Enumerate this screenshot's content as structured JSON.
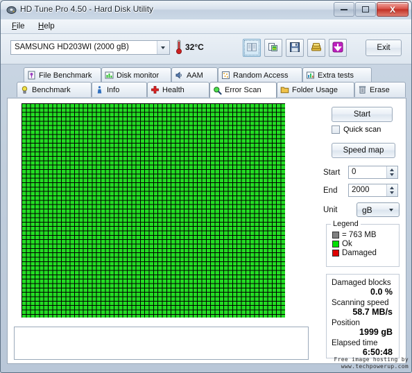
{
  "window": {
    "title": "HD Tune Pro 4.50 - Hard Disk Utility",
    "icon": "app-disk-icon",
    "minimize_label": "Minimize",
    "maximize_label": "Maximize",
    "close_label": "X"
  },
  "menu": {
    "items": [
      {
        "label": "File",
        "mnemonic": "F"
      },
      {
        "label": "Help",
        "mnemonic": "H"
      }
    ]
  },
  "toolbar": {
    "drive": {
      "value": "SAMSUNG HD203WI (2000 gB)",
      "icon": "chevron-down-icon"
    },
    "temperature": {
      "icon": "thermometer-icon",
      "value": "32°C"
    },
    "buttons": [
      {
        "name": "copy-button",
        "icon": "copy-pages-icon",
        "state": "focused"
      },
      {
        "name": "screenshot-button",
        "icon": "image-copy-icon",
        "state": "normal"
      },
      {
        "name": "save-button",
        "icon": "floppy-disk-icon",
        "state": "normal"
      },
      {
        "name": "gold-button",
        "icon": "money-stack-icon",
        "state": "normal"
      },
      {
        "name": "download-button",
        "icon": "purple-down-arrow-icon",
        "state": "normal"
      }
    ],
    "exit_label": "Exit"
  },
  "tabs": {
    "row1": [
      {
        "label": "File Benchmark",
        "icon": "file-benchmark-icon",
        "active": false
      },
      {
        "label": "Disk monitor",
        "icon": "bar-chart-icon",
        "active": false
      },
      {
        "label": "AAM",
        "icon": "speaker-icon",
        "active": false
      },
      {
        "label": "Random Access",
        "icon": "random-dots-icon",
        "active": false
      },
      {
        "label": "Extra tests",
        "icon": "extra-chart-icon",
        "active": false
      }
    ],
    "row2": [
      {
        "label": "Benchmark",
        "icon": "lightbulb-icon",
        "active": false
      },
      {
        "label": "Info",
        "icon": "info-icon",
        "active": false
      },
      {
        "label": "Health",
        "icon": "red-cross-icon",
        "active": false
      },
      {
        "label": "Error Scan",
        "icon": "magnifier-icon",
        "active": true
      },
      {
        "label": "Folder Usage",
        "icon": "folder-icon",
        "active": false
      },
      {
        "label": "Erase",
        "icon": "trash-icon",
        "active": false
      }
    ]
  },
  "scan": {
    "start_button": "Start",
    "quick_scan_label": "Quick scan",
    "quick_scan_checked": false,
    "speed_map_button": "Speed map",
    "fields": [
      {
        "label": "Start",
        "value": "0"
      },
      {
        "label": "End",
        "value": "2000"
      }
    ],
    "unit": {
      "label": "Unit",
      "value": "gB",
      "icon": "chevron-down-icon"
    }
  },
  "legend": {
    "title": "Legend",
    "entries": [
      {
        "label": "= 763 MB",
        "color": "#808080"
      },
      {
        "label": "Ok",
        "color": "#00e000"
      },
      {
        "label": "Damaged",
        "color": "#e00000"
      }
    ]
  },
  "stats": [
    {
      "label": "Damaged blocks",
      "value": "0.0 %"
    },
    {
      "label": "Scanning speed",
      "value": "58.7 MB/s"
    },
    {
      "label": "Position",
      "value": "1999 gB"
    },
    {
      "label": "Elapsed time",
      "value": "6:50:48"
    }
  ],
  "map": {
    "name": "error-scan-block-map",
    "columns": 60,
    "rows": 49,
    "ok_color": "#23dd23",
    "gap_color": "#000000"
  },
  "watermark": {
    "line1": "Free image hosting by",
    "line2": "www.techpowerup.com"
  }
}
